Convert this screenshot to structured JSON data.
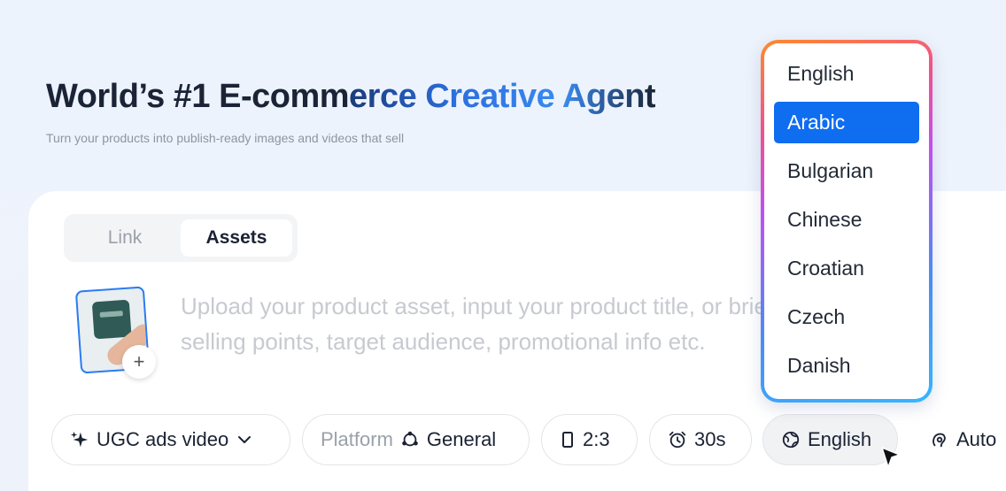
{
  "hero": {
    "title_dark": "World’s #1 E-comm",
    "title_accent": "erce Creative Agent",
    "subtitle": "Turn your products into publish-ready images and videos that sell"
  },
  "tabs": [
    {
      "label": "Link",
      "active": false
    },
    {
      "label": "Assets",
      "active": true
    }
  ],
  "upload": {
    "plus_label": "+",
    "prompt_line1": "Upload your product asset, input your product title, or brief introduce",
    "prompt_line2": "selling points, target audience, promotional info etc."
  },
  "toolbar": {
    "type_label": "UGC ads video",
    "platform_prefix": "Platform",
    "platform_value": "General",
    "ratio": "2:3",
    "duration": "30s",
    "language": "English",
    "voice": "Auto"
  },
  "language_dropdown": {
    "options": [
      "English",
      "Arabic",
      "Bulgarian",
      "Chinese",
      "Croatian",
      "Czech",
      "Danish"
    ],
    "selected": "Arabic"
  },
  "colors": {
    "accent": "#0f6df0",
    "title_blue": "#3a8af0",
    "background": "#eef3fb"
  }
}
